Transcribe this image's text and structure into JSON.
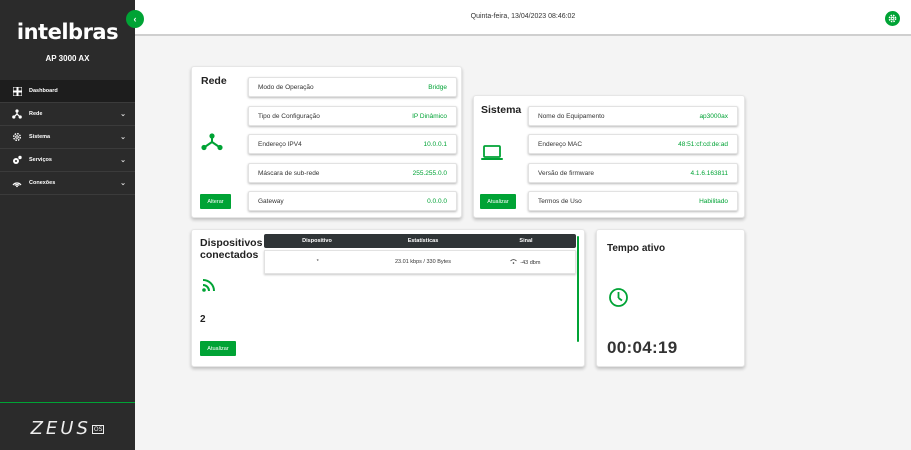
{
  "sidebar": {
    "brand": "intelbras",
    "model": "AP 3000 AX",
    "items": [
      {
        "label": "Dashboard"
      },
      {
        "label": "Rede"
      },
      {
        "label": "Sistema"
      },
      {
        "label": "Serviços"
      },
      {
        "label": "Conexões"
      }
    ],
    "footer_logo": "ZEUS",
    "footer_logo_suffix": "OS"
  },
  "header": {
    "datetime": "Quinta-feira, 13/04/2023 08:46:02"
  },
  "rede": {
    "title": "Rede",
    "rows": [
      {
        "key": "Modo de Operação",
        "value": "Bridge"
      },
      {
        "key": "Tipo de Configuração",
        "value": "IP Dinâmico"
      },
      {
        "key": "Endereço IPV4",
        "value": "10.0.0.1"
      },
      {
        "key": "Máscara de sub-rede",
        "value": "255.255.0.0"
      },
      {
        "key": "Gateway",
        "value": "0.0.0.0"
      }
    ],
    "button": "Alterar"
  },
  "sistema": {
    "title": "Sistema",
    "rows": [
      {
        "key": "Nome do Equipamento",
        "value": "ap3000ax"
      },
      {
        "key": "Endereço MAC",
        "value": "48:51:cf:cd:de:ad"
      },
      {
        "key": "Versão de firmware",
        "value": "4.1.6.163811"
      },
      {
        "key": "Termos de Uso",
        "value": "Habilitado"
      }
    ],
    "button": "Atualizar"
  },
  "dispositivos": {
    "title_line1": "Dispositivos",
    "title_line2": "conectados",
    "count": "2",
    "button": "Atualizar",
    "columns": [
      "Dispositivo",
      "Estatísticas",
      "Sinal"
    ],
    "rows": [
      {
        "dispositivo": "*",
        "estatisticas": "23.01 kbps / 330 Bytes",
        "sinal": "-43 dbm"
      }
    ]
  },
  "tempo": {
    "title": "Tempo ativo",
    "value": "00:04:19"
  },
  "colors": {
    "accent": "#00a335",
    "sidebar_bg": "#2b2b2b",
    "table_head": "#2f3436"
  }
}
